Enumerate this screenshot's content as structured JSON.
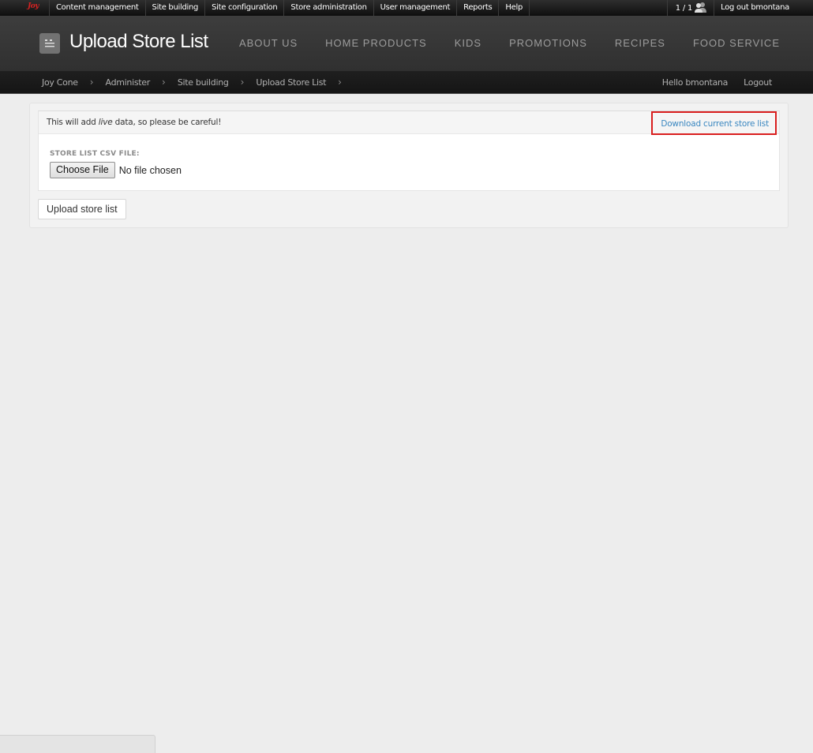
{
  "admin_bar": {
    "logo_text": "Joy",
    "menu": [
      "Content management",
      "Site building",
      "Site configuration",
      "Store administration",
      "User management",
      "Reports",
      "Help"
    ],
    "user_count": "1 / 1",
    "logout": "Log out bmontana"
  },
  "header": {
    "title": "Upload Store List",
    "nav": [
      "ABOUT US",
      "HOME PRODUCTS",
      "KIDS",
      "PROMOTIONS",
      "RECIPES",
      "FOOD SERVICE"
    ]
  },
  "breadcrumb": {
    "items": [
      "Joy Cone",
      "Administer",
      "Site building",
      "Upload Store List"
    ],
    "separator": "›",
    "greeting": "Hello bmontana",
    "logout": "Logout"
  },
  "content": {
    "warning_prefix": "This will add ",
    "warning_emphasis": "live",
    "warning_suffix": " data, so please be careful!",
    "download_link": "Download current store list",
    "file_label": "STORE LIST CSV FILE:",
    "choose_file": "Choose File",
    "no_file": "No file chosen",
    "upload_button": "Upload store list"
  },
  "colors": {
    "highlight_box": "#d91e1e",
    "link": "#3a87c0",
    "logo": "#d82222"
  }
}
